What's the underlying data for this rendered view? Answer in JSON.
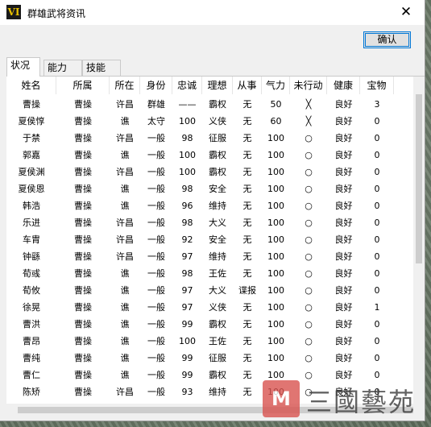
{
  "window": {
    "icon_text": "VI",
    "title": "群雄武将资讯",
    "close_glyph": "✕",
    "ok_label": "确认"
  },
  "tabs": [
    "状况",
    "能力",
    "技能"
  ],
  "table": {
    "headers": [
      "姓名",
      "所属",
      "所在",
      "身份",
      "忠诚",
      "理想",
      "从事",
      "气力",
      "未行动",
      "健康",
      "宝物"
    ],
    "rows": [
      [
        "曹操",
        "曹操",
        "许昌",
        "群雄",
        "——",
        "霸权",
        "无",
        "50",
        "╳",
        "良好",
        "3"
      ],
      [
        "夏侯惇",
        "曹操",
        "谯",
        "太守",
        "100",
        "义侠",
        "无",
        "60",
        "╳",
        "良好",
        "0"
      ],
      [
        "于禁",
        "曹操",
        "许昌",
        "一般",
        "98",
        "征服",
        "无",
        "100",
        "○",
        "良好",
        "0"
      ],
      [
        "郭嘉",
        "曹操",
        "谯",
        "一般",
        "100",
        "霸权",
        "无",
        "100",
        "○",
        "良好",
        "0"
      ],
      [
        "夏侯渊",
        "曹操",
        "许昌",
        "一般",
        "100",
        "霸权",
        "无",
        "100",
        "○",
        "良好",
        "0"
      ],
      [
        "夏侯恩",
        "曹操",
        "谯",
        "一般",
        "98",
        "安全",
        "无",
        "100",
        "○",
        "良好",
        "0"
      ],
      [
        "韩浩",
        "曹操",
        "谯",
        "一般",
        "96",
        "维持",
        "无",
        "100",
        "○",
        "良好",
        "0"
      ],
      [
        "乐进",
        "曹操",
        "许昌",
        "一般",
        "98",
        "大义",
        "无",
        "100",
        "○",
        "良好",
        "0"
      ],
      [
        "车胄",
        "曹操",
        "许昌",
        "一般",
        "92",
        "安全",
        "无",
        "100",
        "○",
        "良好",
        "0"
      ],
      [
        "钟繇",
        "曹操",
        "许昌",
        "一般",
        "97",
        "维持",
        "无",
        "100",
        "○",
        "良好",
        "0"
      ],
      [
        "荀彧",
        "曹操",
        "谯",
        "一般",
        "98",
        "王佐",
        "无",
        "100",
        "○",
        "良好",
        "0"
      ],
      [
        "荀攸",
        "曹操",
        "谯",
        "一般",
        "97",
        "大义",
        "谍报",
        "100",
        "○",
        "良好",
        "0"
      ],
      [
        "徐晃",
        "曹操",
        "谯",
        "一般",
        "97",
        "义侠",
        "无",
        "100",
        "○",
        "良好",
        "1"
      ],
      [
        "曹洪",
        "曹操",
        "谯",
        "一般",
        "99",
        "霸权",
        "无",
        "100",
        "○",
        "良好",
        "0"
      ],
      [
        "曹昂",
        "曹操",
        "谯",
        "一般",
        "100",
        "王佐",
        "无",
        "100",
        "○",
        "良好",
        "0"
      ],
      [
        "曹纯",
        "曹操",
        "谯",
        "一般",
        "99",
        "征服",
        "无",
        "100",
        "○",
        "良好",
        "0"
      ],
      [
        "曹仁",
        "曹操",
        "谯",
        "一般",
        "99",
        "霸权",
        "无",
        "100",
        "○",
        "良好",
        "0"
      ],
      [
        "陈矫",
        "曹操",
        "许昌",
        "一般",
        "93",
        "维持",
        "无",
        "100",
        "○",
        "良好",
        "0"
      ]
    ]
  },
  "watermark": {
    "logo_glyph": "M",
    "text": "三國藝苑"
  }
}
